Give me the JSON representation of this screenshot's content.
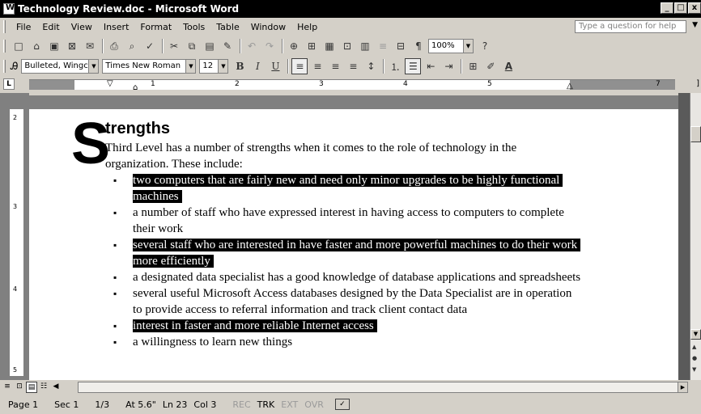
{
  "window": {
    "title": "Technology Review.doc - Microsoft Word",
    "min_label": "_",
    "max_label": "□",
    "close_label": "x"
  },
  "menu": {
    "items": [
      {
        "name": "menu-file",
        "label": "File"
      },
      {
        "name": "menu-edit",
        "label": "Edit"
      },
      {
        "name": "menu-view",
        "label": "View"
      },
      {
        "name": "menu-insert",
        "label": "Insert"
      },
      {
        "name": "menu-format",
        "label": "Format"
      },
      {
        "name": "menu-tools",
        "label": "Tools"
      },
      {
        "name": "menu-table",
        "label": "Table"
      },
      {
        "name": "menu-window",
        "label": "Window"
      },
      {
        "name": "menu-help",
        "label": "Help"
      }
    ],
    "help_placeholder": "Type a question for help"
  },
  "standard_toolbar": {
    "zoom": "100%"
  },
  "formatting_toolbar": {
    "style": "Bulleted, Wingc",
    "font": "Times New Roman",
    "size": "12",
    "bold": "B",
    "italic": "I",
    "underline": "U"
  },
  "ruler": {
    "tab_selector": "L",
    "numbers": [
      "1",
      "2",
      "3",
      "4",
      "5",
      "7"
    ]
  },
  "vruler": {
    "numbers": [
      "2",
      "3",
      "4",
      "5"
    ]
  },
  "document": {
    "drop_cap": "S",
    "heading": "trengths",
    "intro": "Third Level has a number of strengths when it comes to the role of technology in the organization. These include:",
    "bullets": [
      {
        "text": "two computers that are fairly new and need only minor upgrades to be highly functional machines",
        "selected": true
      },
      {
        "text": "a number of staff who have expressed interest in having access to computers to complete their work",
        "selected": false
      },
      {
        "text": "several staff who are interested in have faster and more powerful machines to do their work more efficiently",
        "selected": true
      },
      {
        "text": "a designated data specialist has a good knowledge of database applications and spreadsheets",
        "selected": false
      },
      {
        "text": "several useful Microsoft Access databases designed by the Data Specialist are in operation to provide access to referral information and track client contact data",
        "selected": false
      },
      {
        "text": "interest in faster and more reliable Internet access",
        "selected": true
      },
      {
        "text": "a willingness to learn new things",
        "selected": false
      }
    ]
  },
  "status": {
    "page": "Page 1",
    "sec": "Sec 1",
    "pages": "1/3",
    "at": "At 5.6\"",
    "ln": "Ln 23",
    "col": "Col 3",
    "rec": "REC",
    "trk": "TRK",
    "ext": "EXT",
    "ovr": "OVR"
  }
}
